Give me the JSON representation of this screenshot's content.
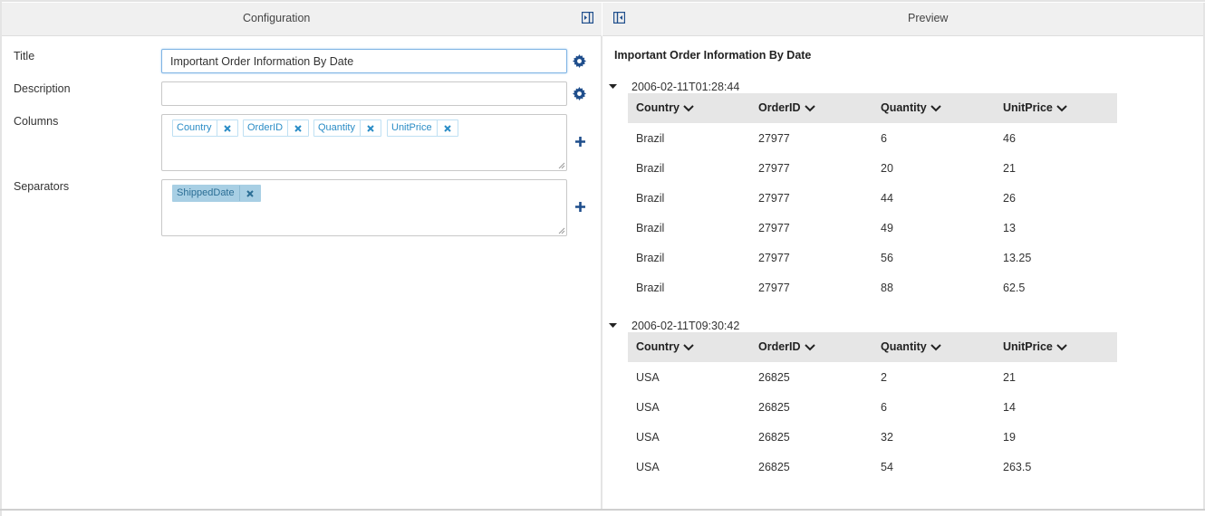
{
  "config": {
    "header_label": "Configuration",
    "title_label": "Title",
    "title_value": "Important Order Information By Date",
    "description_label": "Description",
    "description_value": "",
    "columns_label": "Columns",
    "columns": [
      "Country",
      "OrderID",
      "Quantity",
      "UnitPrice"
    ],
    "separators_label": "Separators",
    "separators": [
      "ShippedDate"
    ]
  },
  "preview": {
    "header_label": "Preview",
    "title": "Important Order Information By Date",
    "column_headers": [
      "Country",
      "OrderID",
      "Quantity",
      "UnitPrice"
    ],
    "groups": [
      {
        "label": "2006-02-11T01:28:44",
        "rows": [
          [
            "Brazil",
            "27977",
            "6",
            "46"
          ],
          [
            "Brazil",
            "27977",
            "20",
            "21"
          ],
          [
            "Brazil",
            "27977",
            "44",
            "26"
          ],
          [
            "Brazil",
            "27977",
            "49",
            "13"
          ],
          [
            "Brazil",
            "27977",
            "56",
            "13.25"
          ],
          [
            "Brazil",
            "27977",
            "88",
            "62.5"
          ]
        ]
      },
      {
        "label": "2006-02-11T09:30:42",
        "rows": [
          [
            "USA",
            "26825",
            "2",
            "21"
          ],
          [
            "USA",
            "26825",
            "6",
            "14"
          ],
          [
            "USA",
            "26825",
            "32",
            "19"
          ],
          [
            "USA",
            "26825",
            "54",
            "263.5"
          ]
        ]
      }
    ]
  },
  "colors": {
    "accent": "#1f4e8c",
    "tag_text": "#2a8cc6",
    "separator_tag_bg": "#a8cfe4"
  },
  "icons": {
    "config_collapse": "collapse-right-icon",
    "preview_collapse": "collapse-left-icon",
    "gear": "gear-icon",
    "plus": "plus-icon",
    "remove": "close-icon",
    "sort": "chevron-down-icon",
    "group_toggle": "caret-down-icon"
  }
}
